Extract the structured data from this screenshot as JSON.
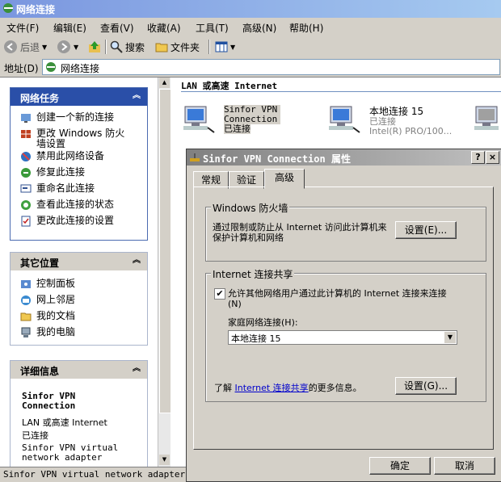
{
  "window": {
    "title": "网络连接"
  },
  "menu": [
    "文件(F)",
    "编辑(E)",
    "查看(V)",
    "收藏(A)",
    "工具(T)",
    "高级(N)",
    "帮助(H)"
  ],
  "toolbar": {
    "back": "后退",
    "search": "搜索",
    "folders": "文件夹"
  },
  "address": {
    "label": "地址(D)",
    "value": "网络连接"
  },
  "left": {
    "tasks": {
      "title": "网络任务",
      "items": [
        "创建一个新的连接",
        "更改 Windows 防火墙设置",
        "禁用此网络设备",
        "修复此连接",
        "重命名此连接",
        "查看此连接的状态",
        "更改此连接的设置"
      ]
    },
    "places": {
      "title": "其它位置",
      "items": [
        "控制面板",
        "网上邻居",
        "我的文档",
        "我的电脑"
      ]
    },
    "details": {
      "title": "详细信息",
      "name": "Sinfor VPN Connection",
      "type": "LAN 或高速 Internet",
      "status": "已连接",
      "device": "Sinfor VPN virtual network adapter"
    }
  },
  "right": {
    "group_header": "LAN 或高速 Internet",
    "connections": [
      {
        "name": "Sinfor VPN Connection",
        "status": "已连接"
      },
      {
        "name": "本地连接 15",
        "status": "已连接",
        "device": "Intel(R) PRO/100..."
      }
    ]
  },
  "status_bar": "Sinfor VPN virtual network adapter",
  "dialog": {
    "title": "Sinfor VPN Connection 属性",
    "help": "?",
    "close": "×",
    "tabs": [
      "常规",
      "验证",
      "高级"
    ],
    "firewall": {
      "title": "Windows 防火墙",
      "text": "通过限制或防止从 Internet 访问此计算机来保护计算机和网络",
      "button": "设置(E)..."
    },
    "ics": {
      "title": "Internet 连接共享",
      "checkbox": "允许其他网络用户通过此计算机的 Internet 连接来连接(N)",
      "home_label": "家庭网络连接(H):",
      "home_value": "本地连接 15",
      "learn_prefix": "了解 ",
      "learn_link": "Internet 连接共享",
      "learn_suffix": "的更多信息。",
      "button": "设置(G)..."
    },
    "ok": "确定",
    "cancel": "取消"
  }
}
